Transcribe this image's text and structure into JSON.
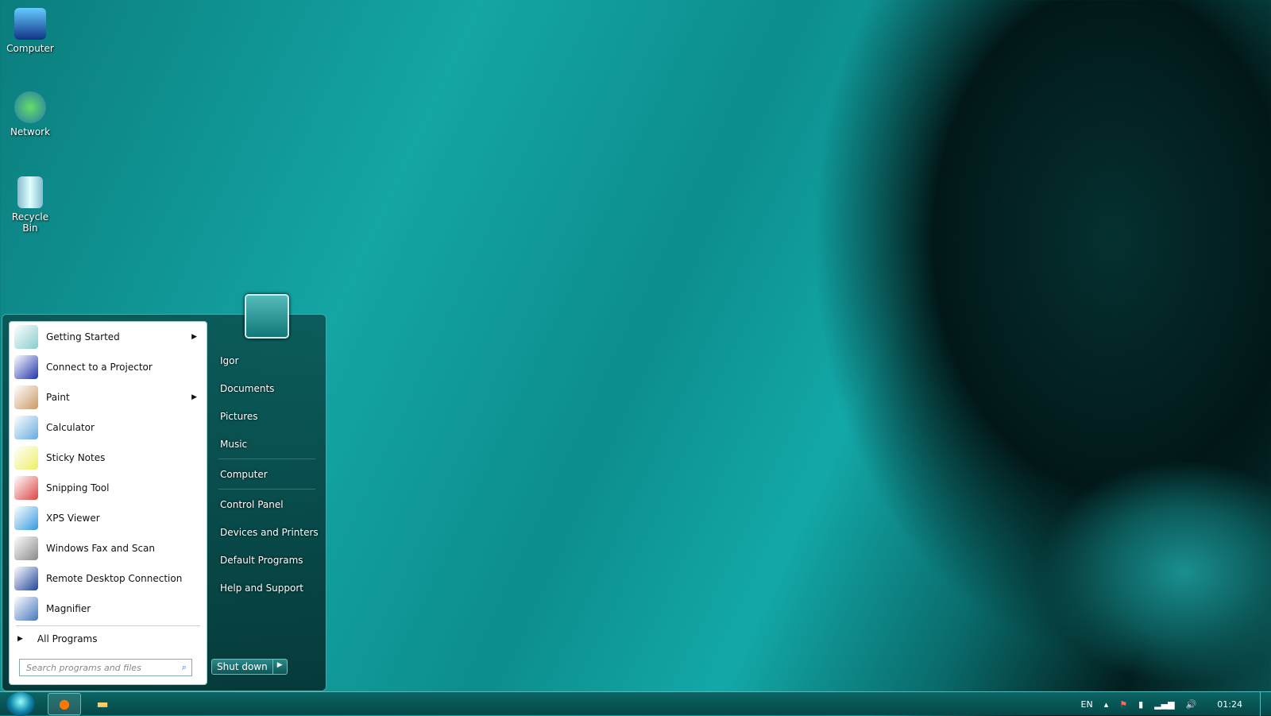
{
  "desktop": {
    "icons": [
      {
        "label": "Computer"
      },
      {
        "label": "Network"
      },
      {
        "label": "Recycle Bin"
      }
    ]
  },
  "start_menu": {
    "programs": [
      {
        "label": "Getting Started",
        "submenu": true,
        "color": "#8cc"
      },
      {
        "label": "Connect to a Projector",
        "submenu": false,
        "color": "#23a"
      },
      {
        "label": "Paint",
        "submenu": true,
        "color": "#c96"
      },
      {
        "label": "Calculator",
        "submenu": false,
        "color": "#6ad"
      },
      {
        "label": "Sticky Notes",
        "submenu": false,
        "color": "#ee6"
      },
      {
        "label": "Snipping Tool",
        "submenu": false,
        "color": "#d44"
      },
      {
        "label": "XPS Viewer",
        "submenu": false,
        "color": "#39d"
      },
      {
        "label": "Windows Fax and Scan",
        "submenu": false,
        "color": "#888"
      },
      {
        "label": "Remote Desktop Connection",
        "submenu": false,
        "color": "#249"
      },
      {
        "label": "Magnifier",
        "submenu": false,
        "color": "#47b"
      }
    ],
    "all_programs": "All Programs",
    "search_placeholder": "Search programs and files",
    "right_items": [
      "Igor",
      "Documents",
      "Pictures",
      "Music",
      "Computer",
      "Control Panel",
      "Devices and Printers",
      "Default Programs",
      "Help and Support"
    ],
    "shutdown": "Shut down"
  },
  "taskbar": {
    "language": "EN",
    "clock": "01:24"
  }
}
